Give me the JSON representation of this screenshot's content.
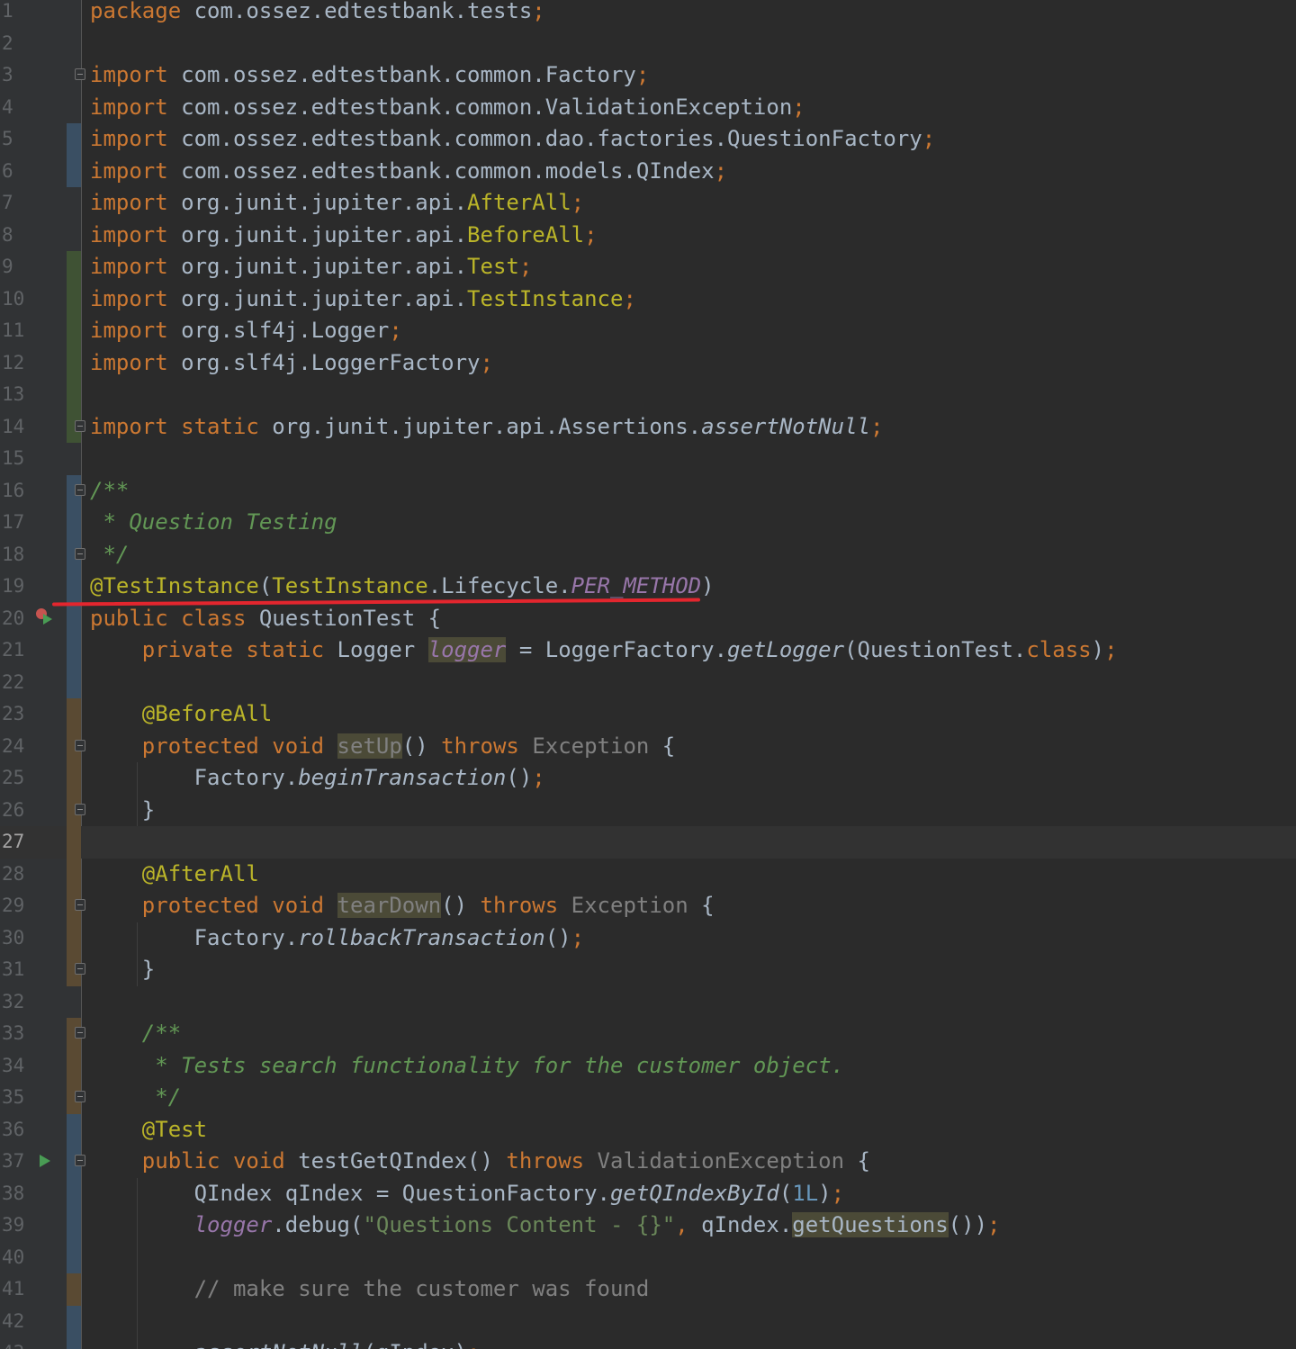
{
  "editor": {
    "language": "java",
    "current_line": 27,
    "colors": {
      "background": "#2b2b2b",
      "keyword": "#cc7832",
      "annotation": "#bbb529",
      "string": "#6a8759",
      "number": "#6897bb",
      "doc_comment": "#629755",
      "comment": "#808080",
      "field": "#9876aa",
      "highlight": "#4b4a37",
      "red_underline": "#e3262e"
    },
    "lines": [
      {
        "n": "1",
        "tokens": [
          [
            "kw",
            "package"
          ],
          [
            "t",
            " com.ossez.edtestbank.tests"
          ],
          [
            "kw",
            ";"
          ]
        ]
      },
      {
        "n": "2",
        "tokens": []
      },
      {
        "n": "3",
        "tokens": [
          [
            "kw",
            "import"
          ],
          [
            "t",
            " com.ossez.edtestbank.common.Factory"
          ],
          [
            "kw",
            ";"
          ]
        ]
      },
      {
        "n": "4",
        "tokens": [
          [
            "kw",
            "import"
          ],
          [
            "t",
            " com.ossez.edtestbank.common.ValidationException"
          ],
          [
            "kw",
            ";"
          ]
        ]
      },
      {
        "n": "5",
        "tokens": [
          [
            "kw",
            "import"
          ],
          [
            "t",
            " com.ossez.edtestbank.common.dao.factories.QuestionFactory"
          ],
          [
            "kw",
            ";"
          ]
        ]
      },
      {
        "n": "6",
        "tokens": [
          [
            "kw",
            "import"
          ],
          [
            "t",
            " com.ossez.edtestbank.common.models.QIndex"
          ],
          [
            "kw",
            ";"
          ]
        ]
      },
      {
        "n": "7",
        "tokens": [
          [
            "kw",
            "import"
          ],
          [
            "t",
            " org.junit.jupiter.api."
          ],
          [
            "ann",
            "AfterAll"
          ],
          [
            "kw",
            ";"
          ]
        ]
      },
      {
        "n": "8",
        "tokens": [
          [
            "kw",
            "import"
          ],
          [
            "t",
            " org.junit.jupiter.api."
          ],
          [
            "ann",
            "BeforeAll"
          ],
          [
            "kw",
            ";"
          ]
        ]
      },
      {
        "n": "9",
        "tokens": [
          [
            "kw",
            "import"
          ],
          [
            "t",
            " org.junit.jupiter.api."
          ],
          [
            "ann",
            "Test"
          ],
          [
            "kw",
            ";"
          ]
        ]
      },
      {
        "n": "10",
        "tokens": [
          [
            "kw",
            "import"
          ],
          [
            "t",
            " org.junit.jupiter.api."
          ],
          [
            "ann",
            "TestInstance"
          ],
          [
            "kw",
            ";"
          ]
        ]
      },
      {
        "n": "11",
        "tokens": [
          [
            "kw",
            "import"
          ],
          [
            "t",
            " org.slf4j.Logger"
          ],
          [
            "kw",
            ";"
          ]
        ]
      },
      {
        "n": "12",
        "tokens": [
          [
            "kw",
            "import"
          ],
          [
            "t",
            " org.slf4j.LoggerFactory"
          ],
          [
            "kw",
            ";"
          ]
        ]
      },
      {
        "n": "13",
        "tokens": []
      },
      {
        "n": "14",
        "tokens": [
          [
            "kw",
            "import static"
          ],
          [
            "t",
            " org.junit.jupiter.api.Assertions."
          ],
          [
            "ital",
            "assertNotNull"
          ],
          [
            "kw",
            ";"
          ]
        ]
      },
      {
        "n": "15",
        "tokens": []
      },
      {
        "n": "16",
        "tokens": [
          [
            "doc",
            "/**"
          ]
        ]
      },
      {
        "n": "17",
        "tokens": [
          [
            "doc",
            " * Question Testing"
          ]
        ]
      },
      {
        "n": "18",
        "tokens": [
          [
            "doc",
            " */"
          ]
        ]
      },
      {
        "n": "19",
        "tokens": [
          [
            "ann",
            "@TestInstance"
          ],
          [
            "t",
            "("
          ],
          [
            "ann",
            "TestInstance"
          ],
          [
            "t",
            ".Lifecycle."
          ],
          [
            "field",
            "PER_METHOD"
          ],
          [
            "t",
            ")"
          ]
        ]
      },
      {
        "n": "20",
        "tokens": [
          [
            "kw",
            "public class"
          ],
          [
            "t",
            " QuestionTest {"
          ]
        ]
      },
      {
        "n": "21",
        "tokens": [
          [
            "t",
            "    "
          ],
          [
            "kw",
            "private static"
          ],
          [
            "t",
            " Logger "
          ],
          [
            "fieldhl",
            "logger"
          ],
          [
            "t",
            " = LoggerFactory."
          ],
          [
            "ital",
            "getLogger"
          ],
          [
            "t",
            "(QuestionTest."
          ],
          [
            "kw",
            "class"
          ],
          [
            "t",
            ")"
          ],
          [
            "kw",
            ";"
          ]
        ]
      },
      {
        "n": "22",
        "tokens": []
      },
      {
        "n": "23",
        "tokens": [
          [
            "t",
            "    "
          ],
          [
            "ann",
            "@BeforeAll"
          ]
        ]
      },
      {
        "n": "24",
        "tokens": [
          [
            "t",
            "    "
          ],
          [
            "kw",
            "protected void"
          ],
          [
            "t",
            " "
          ],
          [
            "unusedhl",
            "setUp"
          ],
          [
            "t",
            "() "
          ],
          [
            "kw",
            "throws"
          ],
          [
            "t",
            " "
          ],
          [
            "unused",
            "Exception"
          ],
          [
            "t",
            " {"
          ]
        ]
      },
      {
        "n": "25",
        "tokens": [
          [
            "t",
            "        Factory."
          ],
          [
            "ital",
            "beginTransaction"
          ],
          [
            "t",
            "()"
          ],
          [
            "kw",
            ";"
          ]
        ]
      },
      {
        "n": "26",
        "tokens": [
          [
            "t",
            "    }"
          ]
        ]
      },
      {
        "n": "27",
        "tokens": []
      },
      {
        "n": "28",
        "tokens": [
          [
            "t",
            "    "
          ],
          [
            "ann",
            "@AfterAll"
          ]
        ]
      },
      {
        "n": "29",
        "tokens": [
          [
            "t",
            "    "
          ],
          [
            "kw",
            "protected void"
          ],
          [
            "t",
            " "
          ],
          [
            "unusedhl",
            "tearDown"
          ],
          [
            "t",
            "() "
          ],
          [
            "kw",
            "throws"
          ],
          [
            "t",
            " "
          ],
          [
            "unused",
            "Exception"
          ],
          [
            "t",
            " {"
          ]
        ]
      },
      {
        "n": "30",
        "tokens": [
          [
            "t",
            "        Factory."
          ],
          [
            "ital",
            "rollbackTransaction"
          ],
          [
            "t",
            "()"
          ],
          [
            "kw",
            ";"
          ]
        ]
      },
      {
        "n": "31",
        "tokens": [
          [
            "t",
            "    }"
          ]
        ]
      },
      {
        "n": "32",
        "tokens": []
      },
      {
        "n": "33",
        "tokens": [
          [
            "t",
            "    "
          ],
          [
            "doc",
            "/**"
          ]
        ]
      },
      {
        "n": "34",
        "tokens": [
          [
            "t",
            "    "
          ],
          [
            "doc",
            " * Tests search functionality for the customer object."
          ]
        ]
      },
      {
        "n": "35",
        "tokens": [
          [
            "t",
            "    "
          ],
          [
            "doc",
            " */"
          ]
        ]
      },
      {
        "n": "36",
        "tokens": [
          [
            "t",
            "    "
          ],
          [
            "ann",
            "@Test"
          ]
        ]
      },
      {
        "n": "37",
        "tokens": [
          [
            "t",
            "    "
          ],
          [
            "kw",
            "public void"
          ],
          [
            "t",
            " testGetQIndex() "
          ],
          [
            "kw",
            "throws"
          ],
          [
            "t",
            " "
          ],
          [
            "unused",
            "ValidationException"
          ],
          [
            "t",
            " {"
          ]
        ]
      },
      {
        "n": "38",
        "tokens": [
          [
            "t",
            "        QIndex qIndex = QuestionFactory."
          ],
          [
            "ital",
            "getQIndexById"
          ],
          [
            "t",
            "("
          ],
          [
            "num",
            "1L"
          ],
          [
            "t",
            ")"
          ],
          [
            "kw",
            ";"
          ]
        ]
      },
      {
        "n": "39",
        "tokens": [
          [
            "t",
            "        "
          ],
          [
            "field",
            "logger"
          ],
          [
            "t",
            ".debug("
          ],
          [
            "str",
            "\"Questions Content - {}\""
          ],
          [
            "kw",
            ","
          ],
          [
            "t",
            " qIndex."
          ],
          [
            "hl",
            "getQuestions"
          ],
          [
            "t",
            "())"
          ],
          [
            "kw",
            ";"
          ]
        ]
      },
      {
        "n": "40",
        "tokens": []
      },
      {
        "n": "41",
        "tokens": [
          [
            "t",
            "        "
          ],
          [
            "cmt",
            "// make sure the customer was found"
          ]
        ]
      },
      {
        "n": "42",
        "tokens": []
      },
      {
        "n": "43",
        "tokens": [
          [
            "t",
            "        "
          ],
          [
            "ital",
            "assertNotNull"
          ],
          [
            "t",
            "(qIndex)"
          ],
          [
            "kw",
            ";"
          ]
        ]
      }
    ]
  }
}
